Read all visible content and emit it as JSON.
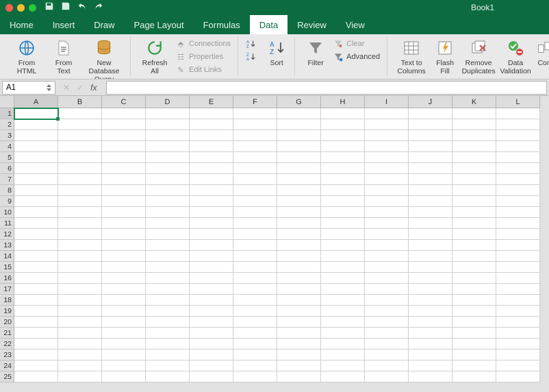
{
  "title": "Book1",
  "tabs": [
    "Home",
    "Insert",
    "Draw",
    "Page Layout",
    "Formulas",
    "Data",
    "Review",
    "View"
  ],
  "active_tab": "Data",
  "ribbon": {
    "from_html": "From\nHTML",
    "from_text": "From\nText",
    "new_db": "New Database\nQuery",
    "refresh": "Refresh\nAll",
    "connections": "Connections",
    "properties": "Properties",
    "edit_links": "Edit Links",
    "sort": "Sort",
    "filter": "Filter",
    "clear": "Clear",
    "advanced": "Advanced",
    "text_cols": "Text to\nColumns",
    "flash_fill": "Flash\nFill",
    "remove_dup": "Remove\nDuplicates",
    "validation": "Data\nValidation",
    "consolidate": "Con"
  },
  "namebox": "A1",
  "columns": [
    "A",
    "B",
    "C",
    "D",
    "E",
    "F",
    "G",
    "H",
    "I",
    "J",
    "K",
    "L"
  ],
  "rows": 25,
  "selected": {
    "row": 1,
    "col": "A"
  }
}
